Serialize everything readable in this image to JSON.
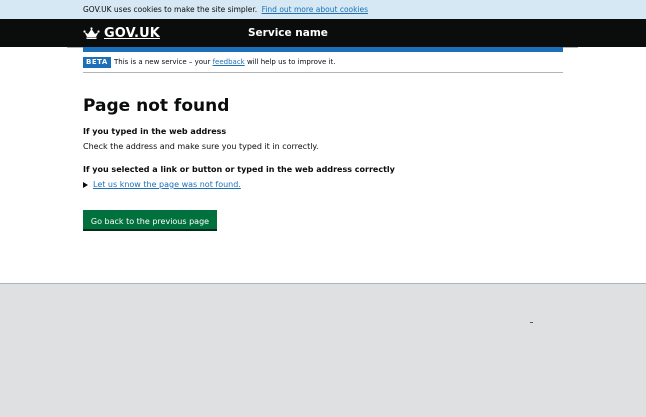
{
  "cookie_banner": {
    "text": "GOV.UK uses cookies to make the site simpler.",
    "link": "Find out more about cookies"
  },
  "header": {
    "logo_text": "GOV.UK",
    "service_name": "Service name"
  },
  "phase_banner": {
    "tag": "BETA",
    "text_before": "This is a new service – your",
    "link": "feedback",
    "text_after": "will help us to improve it."
  },
  "main": {
    "title": "Page not found",
    "section1_heading": "If you typed in the web address",
    "section1_text": "Check the address and make sure you typed it in correctly.",
    "section2_heading": "If you selected a link or button or typed in the web address correctly",
    "details_summary": "Let us know the page was not found.",
    "back_button": "Go back to the previous page"
  },
  "colors": {
    "link": "#1d70b8",
    "brand_bar": "#1d70b8",
    "button": "#00703c",
    "header_bg": "#0b0c0c",
    "cookie_bg": "#d5e8f3",
    "footer_bg": "#dee0e2"
  }
}
